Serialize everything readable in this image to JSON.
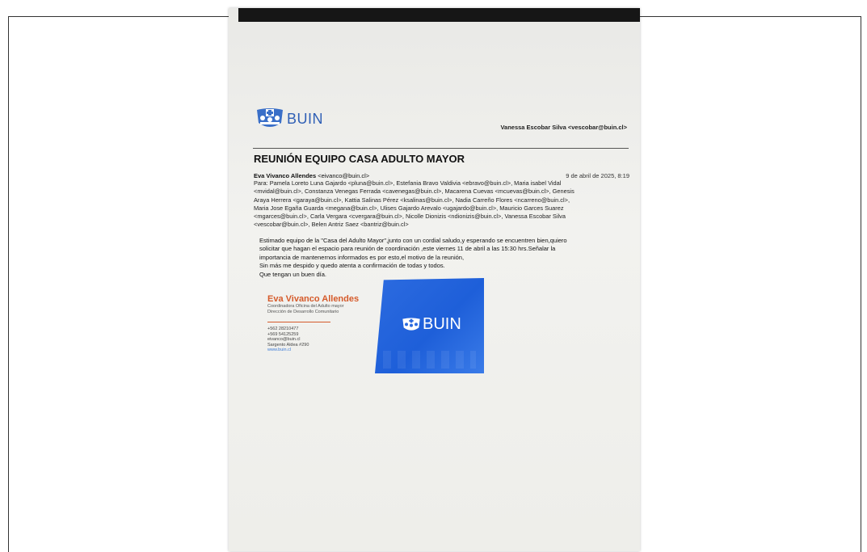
{
  "header": {
    "brand": "BUIN",
    "sender": "Vanessa Escobar Silva <vescobar@buin.cl>"
  },
  "email": {
    "subject": "REUNIÓN EQUIPO CASA ADULTO MAYOR",
    "from_name": "Eva Vivanco Allendes",
    "from_email": "<eivanco@buin.cl>",
    "date": "9 de abril de 2025, 8:19",
    "to_lines": [
      "Para: Pamela Loreto Luna Gajardo <pluna@buin.cl>, Estefania Bravo Valdivia <ebravo@buin.cl>, Maria isabel Vidal",
      "<mvidal@buin.cl>, Constanza Venegas Ferrada <cavenegas@buin.cl>, Macarena Cuevas <mcuevas@buin.cl>, Genesis",
      "Araya Herrera <garaya@buin.cl>, Kattia Salinas Pérez <ksalinas@buin.cl>, Nadia Carreño Flores <ncarreno@buin.cl>,",
      "Maria Jose Egaña Guarda <megana@buin.cl>, Ulises Gajardo Arevalo <ugajardo@buin.cl>, Mauricio Garces Suarez",
      "<mgarces@buin.cl>, Carla Vergara <cvergara@buin.cl>, Nicolle Dionizis <ndionizis@buin.cl>, Vanessa Escobar Silva",
      "<vescobar@buin.cl>, Belen Antriz Saez <bantriz@buin.cl>"
    ],
    "body": [
      "Estimado equipo de la \"Casa del Adulto Mayor\",junto con un cordial saludo,y esperando  se encuentren bien,quiero",
      "solicitar  que hagan el espacio para reunión de coordinación ,este viernes 11 de abril a las 15:30 hrs.Señalar la",
      "importancia de mantenernos informados es por esto,el motivo de la reunión,",
      "Sin más me despido y quedo atenta a confirmación de todas y todos.",
      "Que tengan un buen día."
    ]
  },
  "signature": {
    "name": "Eva Vivanco Allendes",
    "role_1": "Coordinadora Oficina del Adulto mayor",
    "role_2": "Dirección de Desarrollo Comunitario",
    "phone_1": "+562 28210477",
    "phone_2": "+569 54125259",
    "email": "eivanco@buin.cl",
    "address": "Sargento Aldea #290",
    "web": "www.buin.cl",
    "banner_brand": "BUIN"
  },
  "colors": {
    "brand_blue": "#2f5fb5",
    "signature_orange": "#d55a2a",
    "banner_blue": "#1e5fd9"
  },
  "icons": {
    "logo": "buin-municipal-shield-icon"
  }
}
